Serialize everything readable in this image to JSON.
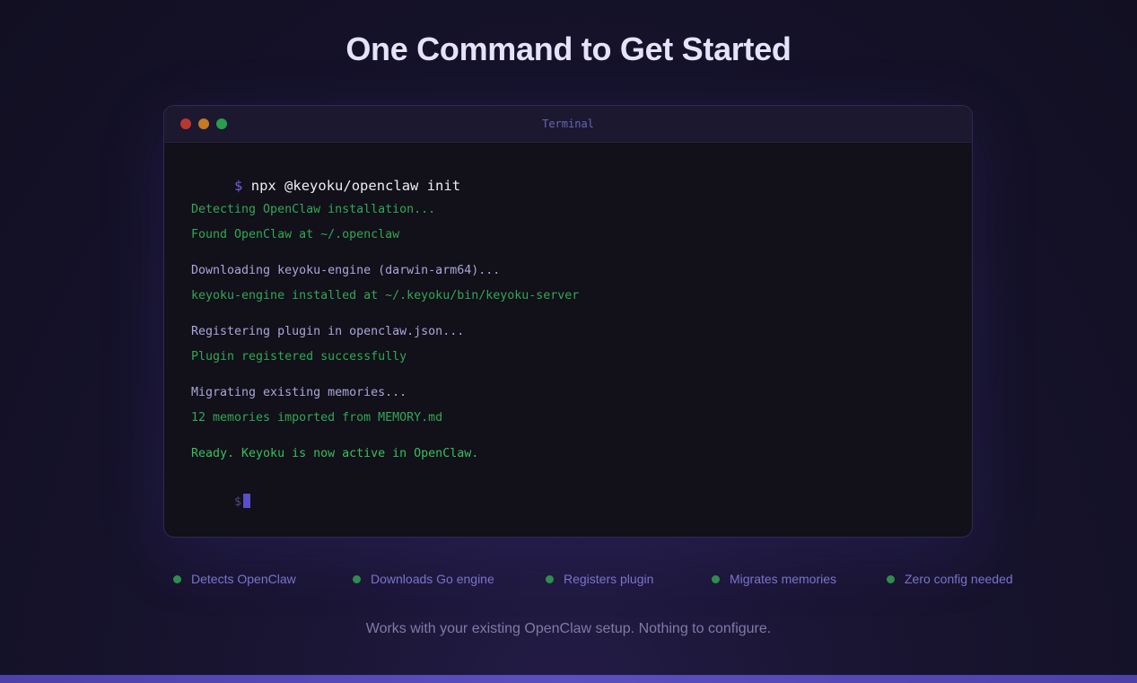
{
  "page": {
    "title": "One Command to Get Started",
    "subtitle": "Works with your existing OpenClaw setup. Nothing to configure."
  },
  "terminal": {
    "window_title": "Terminal",
    "prompt_symbol": "$",
    "command": "npx @keyoku/openclaw init",
    "lines": [
      {
        "text": "Detecting OpenClaw installation...",
        "kind": "ok"
      },
      {
        "text": "Found OpenClaw at ~/.openclaw",
        "kind": "ok"
      },
      {
        "text": "Downloading keyoku-engine (darwin-arm64)...",
        "kind": "info"
      },
      {
        "text": "keyoku-engine installed at ~/.keyoku/bin/keyoku-server",
        "kind": "ok"
      },
      {
        "text": "Registering plugin in openclaw.json...",
        "kind": "info"
      },
      {
        "text": "Plugin registered successfully",
        "kind": "ok"
      },
      {
        "text": "Migrating existing memories...",
        "kind": "info"
      },
      {
        "text": "12 memories imported from MEMORY.md",
        "kind": "ok"
      },
      {
        "text": "Ready. Keyoku is now active in OpenClaw.",
        "kind": "ready"
      }
    ],
    "final_prompt": "$"
  },
  "features": [
    {
      "label": "Detects OpenClaw"
    },
    {
      "label": "Downloads Go engine"
    },
    {
      "label": "Registers plugin"
    },
    {
      "label": "Migrates memories"
    },
    {
      "label": "Zero config needed"
    }
  ],
  "colors": {
    "background": "#15122a",
    "accent": "#5b4fbf",
    "success_green": "#2fa856",
    "info_text": "#a8a6dc"
  }
}
